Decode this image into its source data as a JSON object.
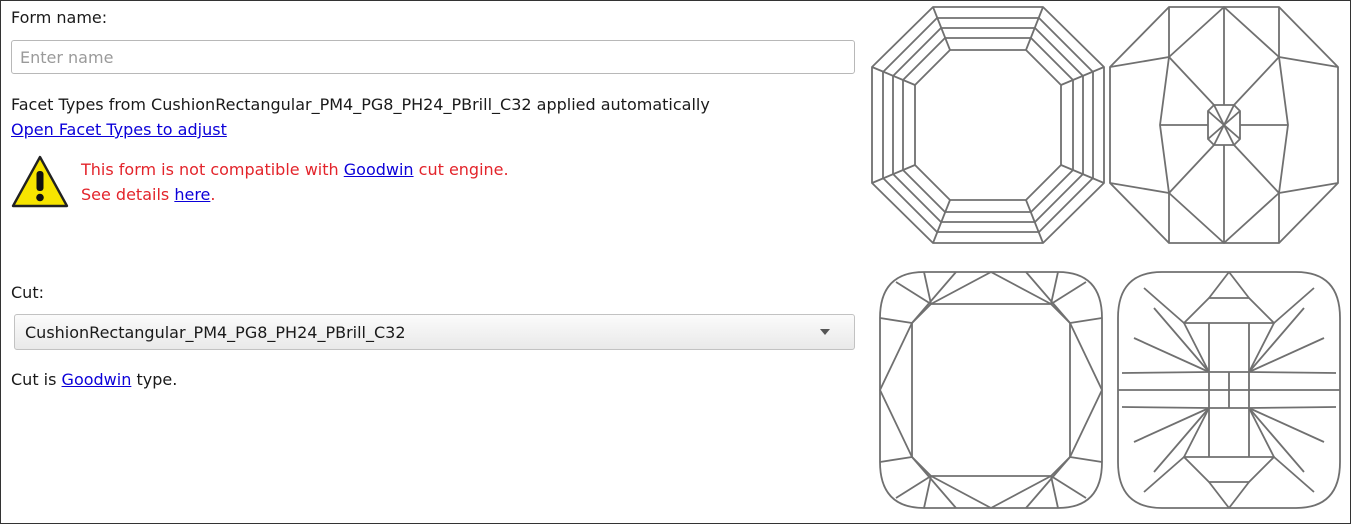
{
  "form": {
    "name_label": "Form name:",
    "name_placeholder": "Enter name",
    "name_value": "",
    "info_text": "Facet Types from CushionRectangular_PM4_PG8_PH24_PBrill_C32 applied automatically",
    "adjust_link": "Open Facet Types to adjust",
    "warning": {
      "icon": "warning-icon",
      "line1_prefix": "This form is not compatible with ",
      "line1_link": "Goodwin",
      "line1_suffix": " cut engine.",
      "line2_prefix": "See details ",
      "line2_link": "here",
      "line2_suffix": ".",
      "color": "#e3242b"
    }
  },
  "cut": {
    "label": "Cut:",
    "selected": "CushionRectangular_PM4_PG8_PH24_PBrill_C32",
    "type_prefix": "Cut is ",
    "type_link": "Goodwin",
    "type_suffix": " type."
  },
  "colors": {
    "link": "#0b00d9",
    "diagram_stroke": "#707070"
  }
}
